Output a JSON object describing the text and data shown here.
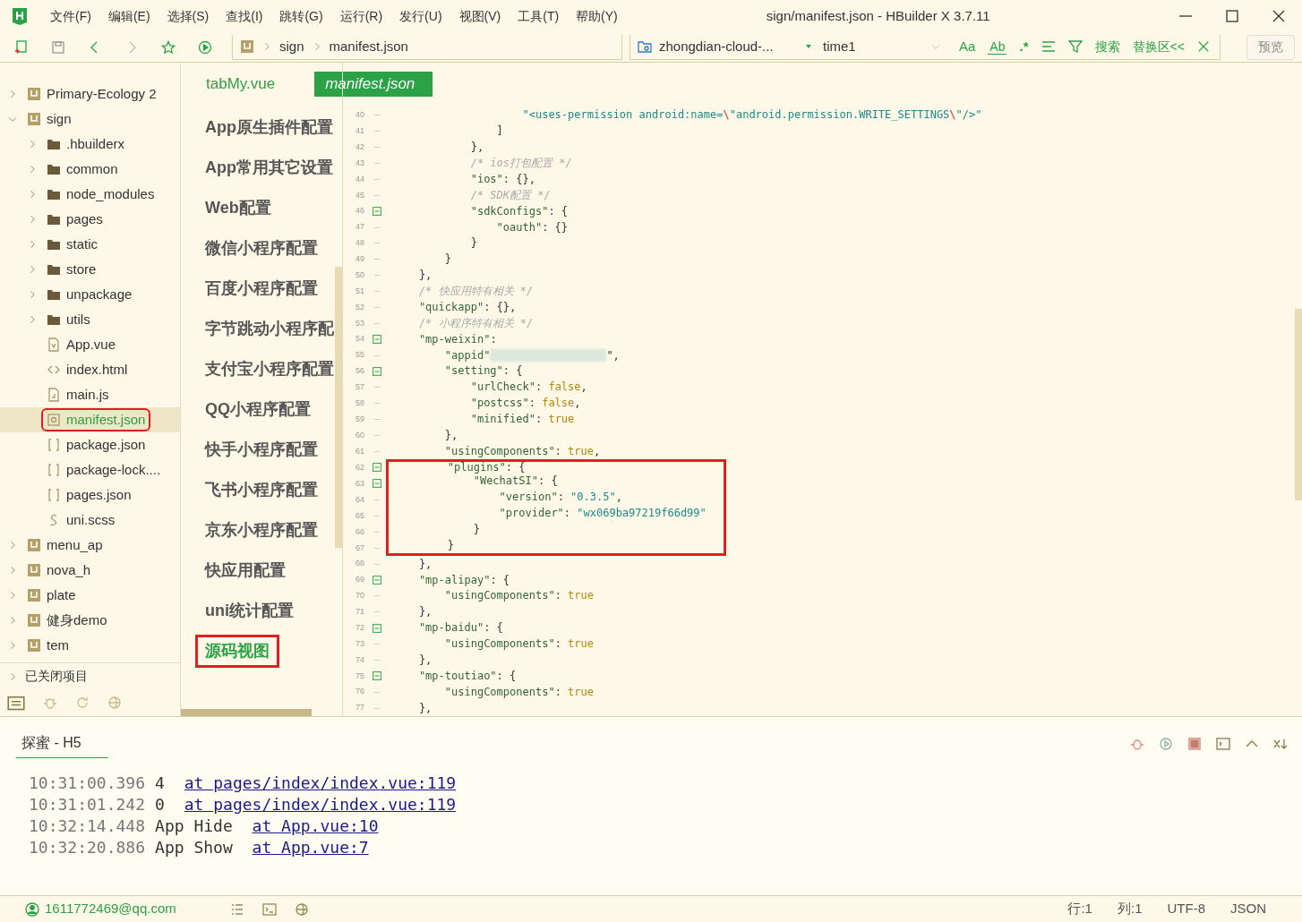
{
  "window": {
    "title": "sign/manifest.json - HBuilder X 3.7.11"
  },
  "menu": [
    "文件(F)",
    "编辑(E)",
    "选择(S)",
    "查找(I)",
    "跳转(G)",
    "运行(R)",
    "发行(U)",
    "视图(V)",
    "工具(T)",
    "帮助(Y)"
  ],
  "breadcrumb": [
    "sign",
    "manifest.json"
  ],
  "find_bar": {
    "scope": "zhongdian-cloud-...",
    "value": "time1",
    "match_case": "Aa",
    "whole_word": "Ab",
    "regex": ".*",
    "search": "搜索",
    "replace": "替换区<<"
  },
  "preview_button": "预览",
  "tree": [
    {
      "label": "Primary-Ecology 2",
      "kind": "project",
      "expanded": false,
      "selected": false,
      "highlighted": false
    },
    {
      "label": "sign",
      "kind": "project",
      "expanded": true,
      "selected": false,
      "highlighted": false,
      "children": [
        {
          "label": ".hbuilderx",
          "kind": "folder",
          "expanded": false,
          "selected": false,
          "highlighted": false
        },
        {
          "label": "common",
          "kind": "folder",
          "expanded": false,
          "selected": false,
          "highlighted": false
        },
        {
          "label": "node_modules",
          "kind": "folder",
          "expanded": false,
          "selected": false,
          "highlighted": false
        },
        {
          "label": "pages",
          "kind": "folder",
          "expanded": false,
          "selected": false,
          "highlighted": false
        },
        {
          "label": "static",
          "kind": "folder",
          "expanded": false,
          "selected": false,
          "highlighted": false
        },
        {
          "label": "store",
          "kind": "folder",
          "expanded": false,
          "selected": false,
          "highlighted": false
        },
        {
          "label": "unpackage",
          "kind": "folder",
          "expanded": false,
          "selected": false,
          "highlighted": false
        },
        {
          "label": "utils",
          "kind": "folder",
          "expanded": false,
          "selected": false,
          "highlighted": false
        },
        {
          "label": "App.vue",
          "kind": "vue",
          "selected": false,
          "highlighted": false
        },
        {
          "label": "index.html",
          "kind": "html",
          "selected": false,
          "highlighted": false
        },
        {
          "label": "main.js",
          "kind": "js",
          "selected": false,
          "highlighted": false
        },
        {
          "label": "manifest.json",
          "kind": "manifest",
          "selected": true,
          "highlighted": true
        },
        {
          "label": "package.json",
          "kind": "json",
          "selected": false,
          "highlighted": false
        },
        {
          "label": "package-lock....",
          "kind": "json",
          "selected": false,
          "highlighted": false
        },
        {
          "label": "pages.json",
          "kind": "json",
          "selected": false,
          "highlighted": false
        },
        {
          "label": "uni.scss",
          "kind": "scss",
          "selected": false,
          "highlighted": false
        }
      ]
    },
    {
      "label": "menu_ap",
      "kind": "project",
      "expanded": false,
      "selected": false,
      "highlighted": false
    },
    {
      "label": "nova_h",
      "kind": "project",
      "expanded": false,
      "selected": false,
      "highlighted": false
    },
    {
      "label": "plate",
      "kind": "project",
      "expanded": false,
      "selected": false,
      "highlighted": false
    },
    {
      "label": "健身demo",
      "kind": "project",
      "expanded": false,
      "selected": false,
      "highlighted": false
    },
    {
      "label": "tem",
      "kind": "project",
      "expanded": false,
      "selected": false,
      "highlighted": false
    }
  ],
  "closed_projects": "已关闭项目",
  "tabs": [
    {
      "label": "tabMy.vue",
      "selected": false
    },
    {
      "label": "manifest.json",
      "selected": true
    }
  ],
  "config_nav": [
    {
      "label": "App原生插件配置",
      "selected": false,
      "highlighted": false
    },
    {
      "label": "App常用其它设置",
      "selected": false,
      "highlighted": false
    },
    {
      "label": "Web配置",
      "selected": false,
      "highlighted": false
    },
    {
      "label": "微信小程序配置",
      "selected": false,
      "highlighted": false
    },
    {
      "label": "百度小程序配置",
      "selected": false,
      "highlighted": false
    },
    {
      "label": "字节跳动小程序配",
      "selected": false,
      "highlighted": false
    },
    {
      "label": "支付宝小程序配置",
      "selected": false,
      "highlighted": false
    },
    {
      "label": "QQ小程序配置",
      "selected": false,
      "highlighted": false
    },
    {
      "label": "快手小程序配置",
      "selected": false,
      "highlighted": false
    },
    {
      "label": "飞书小程序配置",
      "selected": false,
      "highlighted": false
    },
    {
      "label": "京东小程序配置",
      "selected": false,
      "highlighted": false
    },
    {
      "label": "快应用配置",
      "selected": false,
      "highlighted": false
    },
    {
      "label": "uni统计配置",
      "selected": false,
      "highlighted": false
    },
    {
      "label": "源码视图",
      "selected": true,
      "highlighted": true
    }
  ],
  "code": [
    {
      "number": "40",
      "fold": false,
      "annotated": false,
      "segments": [
        {
          "kind": "string",
          "text": "                    \"<uses-permission android:name="
        },
        {
          "kind": "escape",
          "text": "\\"
        },
        {
          "kind": "string",
          "text": "\"android.permission.WRITE_SETTINGS"
        },
        {
          "kind": "escape",
          "text": "\\"
        },
        {
          "kind": "string",
          "text": "\"/>\""
        }
      ]
    },
    {
      "number": "41",
      "fold": false,
      "annotated": false,
      "segments": [
        {
          "kind": "plain",
          "text": "                ]"
        }
      ]
    },
    {
      "number": "42",
      "fold": false,
      "annotated": false,
      "segments": [
        {
          "kind": "plain",
          "text": "            },"
        }
      ]
    },
    {
      "number": "43",
      "fold": false,
      "annotated": false,
      "segments": [
        {
          "kind": "comment",
          "text": "            /* ios打包配置 */"
        }
      ]
    },
    {
      "number": "44",
      "fold": false,
      "annotated": false,
      "segments": [
        {
          "kind": "key",
          "text": "            \"ios\""
        },
        {
          "kind": "plain",
          "text": ": {},"
        }
      ]
    },
    {
      "number": "45",
      "fold": false,
      "annotated": false,
      "segments": [
        {
          "kind": "comment",
          "text": "            /* SDK配置 */"
        }
      ]
    },
    {
      "number": "46",
      "fold": true,
      "annotated": false,
      "segments": [
        {
          "kind": "key",
          "text": "            \"sdkConfigs\""
        },
        {
          "kind": "plain",
          "text": ": {"
        }
      ]
    },
    {
      "number": "47",
      "fold": false,
      "annotated": false,
      "segments": [
        {
          "kind": "key",
          "text": "                \"oauth\""
        },
        {
          "kind": "plain",
          "text": ": {}"
        }
      ]
    },
    {
      "number": "48",
      "fold": false,
      "annotated": false,
      "segments": [
        {
          "kind": "plain",
          "text": "            }"
        }
      ]
    },
    {
      "number": "49",
      "fold": false,
      "annotated": false,
      "segments": [
        {
          "kind": "plain",
          "text": "        }"
        }
      ]
    },
    {
      "number": "50",
      "fold": false,
      "annotated": false,
      "segments": [
        {
          "kind": "plain",
          "text": "    },"
        }
      ]
    },
    {
      "number": "51",
      "fold": false,
      "annotated": false,
      "segments": [
        {
          "kind": "comment",
          "text": "    /* 快应用特有相关 */"
        }
      ]
    },
    {
      "number": "52",
      "fold": false,
      "annotated": false,
      "segments": [
        {
          "kind": "key",
          "text": "    \"quickapp\""
        },
        {
          "kind": "plain",
          "text": ": {},"
        }
      ]
    },
    {
      "number": "53",
      "fold": false,
      "annotated": false,
      "segments": [
        {
          "kind": "comment",
          "text": "    /* 小程序特有相关 */"
        }
      ]
    },
    {
      "number": "54",
      "fold": true,
      "annotated": false,
      "segments": [
        {
          "kind": "key",
          "text": "    \"mp-weixin\""
        },
        {
          "kind": "plain",
          "text": ":"
        }
      ]
    },
    {
      "number": "55",
      "fold": false,
      "annotated": false,
      "segments": [
        {
          "kind": "key",
          "text": "        \"appid\""
        },
        {
          "kind": "redacted"
        },
        {
          "kind": "plain",
          "text": "\","
        }
      ]
    },
    {
      "number": "56",
      "fold": true,
      "annotated": false,
      "segments": [
        {
          "kind": "key",
          "text": "        \"setting\""
        },
        {
          "kind": "plain",
          "text": ": {"
        }
      ]
    },
    {
      "number": "57",
      "fold": false,
      "annotated": false,
      "segments": [
        {
          "kind": "key",
          "text": "            \"urlCheck\""
        },
        {
          "kind": "plain",
          "text": ": "
        },
        {
          "kind": "bool",
          "text": "false"
        },
        {
          "kind": "plain",
          "text": ","
        }
      ]
    },
    {
      "number": "58",
      "fold": false,
      "annotated": false,
      "segments": [
        {
          "kind": "key",
          "text": "            \"postcss\""
        },
        {
          "kind": "plain",
          "text": ": "
        },
        {
          "kind": "bool",
          "text": "false"
        },
        {
          "kind": "plain",
          "text": ","
        }
      ]
    },
    {
      "number": "59",
      "fold": false,
      "annotated": false,
      "segments": [
        {
          "kind": "key",
          "text": "            \"minified\""
        },
        {
          "kind": "plain",
          "text": ": "
        },
        {
          "kind": "bool",
          "text": "true"
        }
      ]
    },
    {
      "number": "60",
      "fold": false,
      "annotated": false,
      "segments": [
        {
          "kind": "plain",
          "text": "        },"
        }
      ]
    },
    {
      "number": "61",
      "fold": false,
      "annotated": false,
      "segments": [
        {
          "kind": "key",
          "text": "        \"usingComponents\""
        },
        {
          "kind": "plain",
          "text": ": "
        },
        {
          "kind": "bool",
          "text": "true"
        },
        {
          "kind": "plain",
          "text": ","
        }
      ]
    },
    {
      "number": "62",
      "fold": true,
      "annotated": true,
      "segments": [
        {
          "kind": "key",
          "text": "        \"plugins\""
        },
        {
          "kind": "plain",
          "text": ": {"
        }
      ]
    },
    {
      "number": "63",
      "fold": true,
      "annotated": true,
      "segments": [
        {
          "kind": "key",
          "text": "            \"WechatSI\""
        },
        {
          "kind": "plain",
          "text": ": {"
        }
      ]
    },
    {
      "number": "64",
      "fold": false,
      "annotated": true,
      "segments": [
        {
          "kind": "key",
          "text": "                \"version\""
        },
        {
          "kind": "plain",
          "text": ": "
        },
        {
          "kind": "string",
          "text": "\"0.3.5\""
        },
        {
          "kind": "plain",
          "text": ","
        }
      ]
    },
    {
      "number": "65",
      "fold": false,
      "annotated": true,
      "segments": [
        {
          "kind": "key",
          "text": "                \"provider\""
        },
        {
          "kind": "plain",
          "text": ": "
        },
        {
          "kind": "string",
          "text": "\"wx069ba97219f66d99\""
        }
      ]
    },
    {
      "number": "66",
      "fold": false,
      "annotated": true,
      "segments": [
        {
          "kind": "plain",
          "text": "            }"
        }
      ]
    },
    {
      "number": "67",
      "fold": false,
      "annotated": true,
      "segments": [
        {
          "kind": "plain",
          "text": "        }"
        }
      ]
    },
    {
      "number": "68",
      "fold": false,
      "annotated": false,
      "segments": [
        {
          "kind": "plain",
          "text": "    },"
        }
      ]
    },
    {
      "number": "69",
      "fold": true,
      "annotated": false,
      "segments": [
        {
          "kind": "key",
          "text": "    \"mp-alipay\""
        },
        {
          "kind": "plain",
          "text": ": {"
        }
      ]
    },
    {
      "number": "70",
      "fold": false,
      "annotated": false,
      "segments": [
        {
          "kind": "key",
          "text": "        \"usingComponents\""
        },
        {
          "kind": "plain",
          "text": ": "
        },
        {
          "kind": "bool",
          "text": "true"
        }
      ]
    },
    {
      "number": "71",
      "fold": false,
      "annotated": false,
      "segments": [
        {
          "kind": "plain",
          "text": "    },"
        }
      ]
    },
    {
      "number": "72",
      "fold": true,
      "annotated": false,
      "segments": [
        {
          "kind": "key",
          "text": "    \"mp-baidu\""
        },
        {
          "kind": "plain",
          "text": ": {"
        }
      ]
    },
    {
      "number": "73",
      "fold": false,
      "annotated": false,
      "segments": [
        {
          "kind": "key",
          "text": "        \"usingComponents\""
        },
        {
          "kind": "plain",
          "text": ": "
        },
        {
          "kind": "bool",
          "text": "true"
        }
      ]
    },
    {
      "number": "74",
      "fold": false,
      "annotated": false,
      "segments": [
        {
          "kind": "plain",
          "text": "    },"
        }
      ]
    },
    {
      "number": "75",
      "fold": true,
      "annotated": false,
      "segments": [
        {
          "kind": "key",
          "text": "    \"mp-toutiao\""
        },
        {
          "kind": "plain",
          "text": ": {"
        }
      ]
    },
    {
      "number": "76",
      "fold": false,
      "annotated": false,
      "segments": [
        {
          "kind": "key",
          "text": "        \"usingComponents\""
        },
        {
          "kind": "plain",
          "text": ": "
        },
        {
          "kind": "bool",
          "text": "true"
        }
      ]
    },
    {
      "number": "77",
      "fold": false,
      "annotated": false,
      "segments": [
        {
          "kind": "plain",
          "text": "    },"
        }
      ]
    }
  ],
  "console": {
    "tab": "探蜜 - H5",
    "lines": [
      {
        "time": "10:31:00.396",
        "message": "4 ",
        "link": "at pages/index/index.vue:119"
      },
      {
        "time": "10:31:01.242",
        "message": "0 ",
        "link": "at pages/index/index.vue:119"
      },
      {
        "time": "10:32:14.448",
        "message": "App Hide ",
        "link": "at App.vue:10"
      },
      {
        "time": "10:32:20.886",
        "message": "App Show ",
        "link": "at App.vue:7"
      }
    ]
  },
  "status_bar": {
    "account": "1611772469@qq.com",
    "line": "行:1",
    "column": "列:1",
    "encoding": "UTF-8",
    "language": "JSON"
  }
}
